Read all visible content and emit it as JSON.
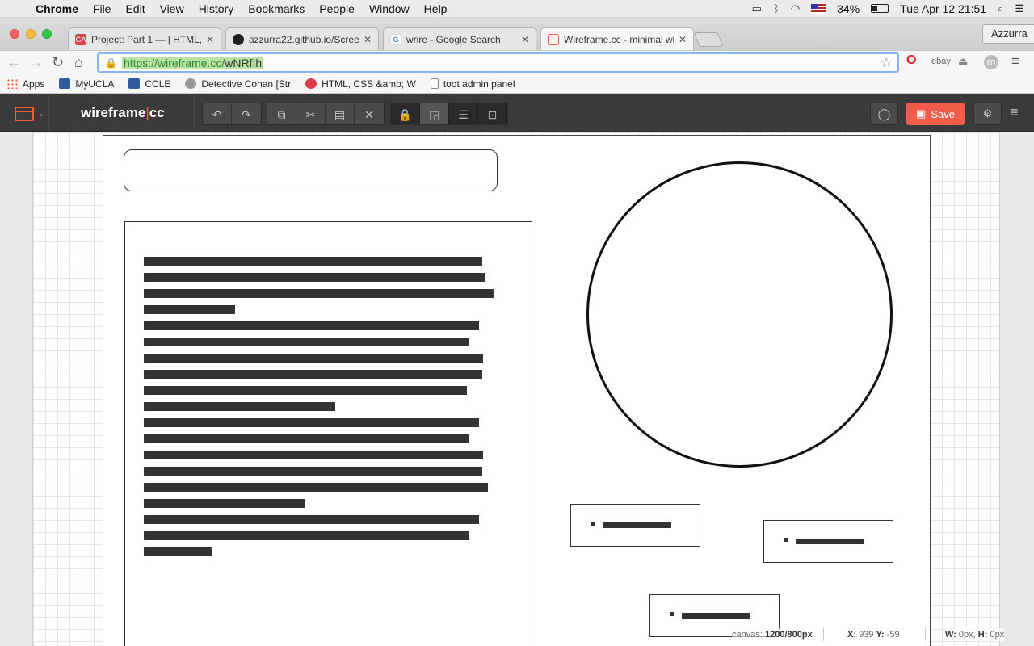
{
  "menubar": {
    "app": "Chrome",
    "items": [
      "File",
      "Edit",
      "View",
      "History",
      "Bookmarks",
      "People",
      "Window",
      "Help"
    ],
    "battery": "34%",
    "clock": "Tue Apr 12  21:51"
  },
  "tabs": [
    {
      "title": "Project: Part 1 — | HTML, C",
      "favicon_color": "#e0394a"
    },
    {
      "title": "azzurra22.github.io/Screen",
      "favicon_color": "#222222"
    },
    {
      "title": "wrire - Google Search",
      "favicon_color": "#4285f4"
    },
    {
      "title": "Wireframe.cc - minimal wir",
      "favicon_color": "#f15c3a"
    }
  ],
  "profile": "Azzurra",
  "address": {
    "url_host": "https://wireframe.cc/",
    "url_path": "wNRfIh"
  },
  "bookmarks": [
    {
      "label": "Apps",
      "icon": "apps-grid-icon",
      "color": "#e0394a"
    },
    {
      "label": "MyUCLA",
      "icon": "ucla-icon",
      "color": "#2d5d9f"
    },
    {
      "label": "CCLE",
      "icon": "ucla-icon",
      "color": "#2d5d9f"
    },
    {
      "label": "Detective Conan [Str",
      "icon": "globe-icon",
      "color": "#888888"
    },
    {
      "label": "HTML, CSS &amp; W",
      "icon": "ga-icon",
      "color": "#e0394a"
    },
    {
      "label": "toot admin panel",
      "icon": "page-icon",
      "color": "#ffffff"
    }
  ],
  "app": {
    "brand_left": "wireframe",
    "brand_sep": "|",
    "brand_right": "cc",
    "save_label": "Save",
    "accent": "#f15c3a"
  },
  "statusbar": {
    "canvas_label": "canvas:",
    "canvas_value": "1200/800px",
    "x_label": "X:",
    "x_value": "939",
    "y_label": "Y:",
    "y_value": "-59",
    "w_label": "W:",
    "w_value": "0px,",
    "h_label": "H:",
    "h_value": "0px"
  }
}
